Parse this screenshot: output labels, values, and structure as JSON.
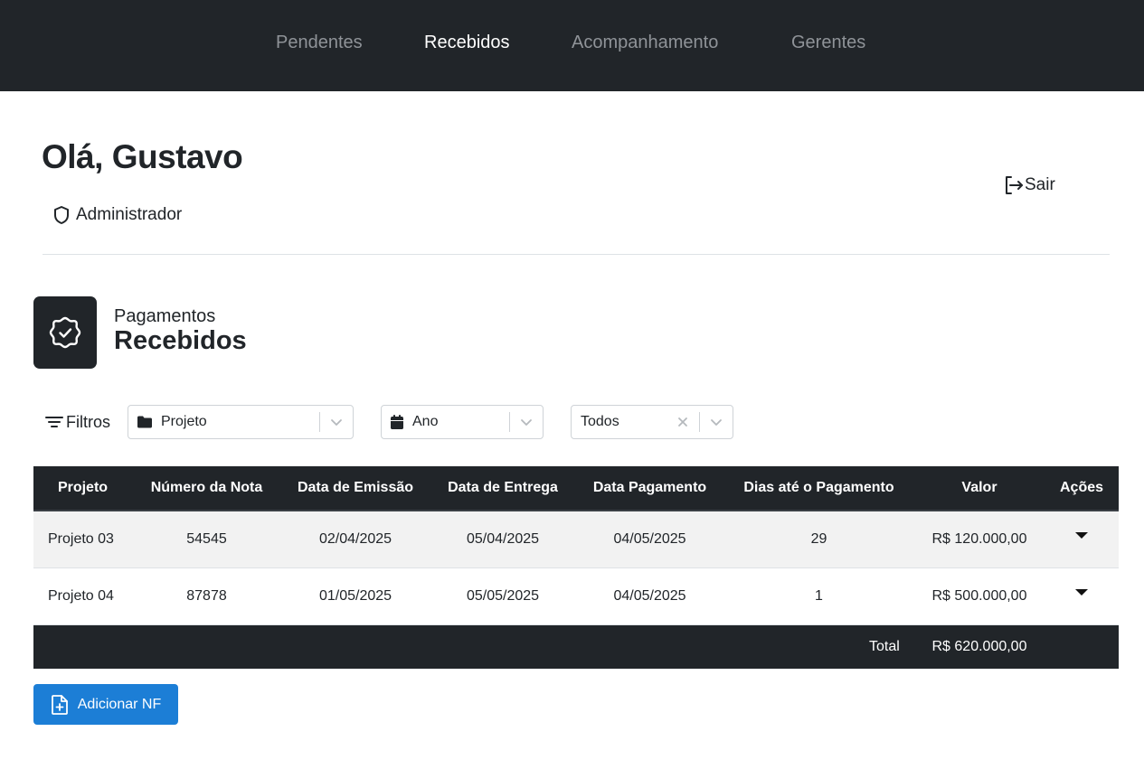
{
  "nav": {
    "items": [
      {
        "label": "Pendentes",
        "active": false
      },
      {
        "label": "Recebidos",
        "active": true
      },
      {
        "label": "Acompanhamento",
        "active": false
      },
      {
        "label": "Gerentes",
        "active": false
      }
    ]
  },
  "header": {
    "greeting": "Olá, Gustavo",
    "role": "Administrador",
    "role_icon": "shield-icon",
    "logout_label": "Sair",
    "logout_icon": "logout-icon"
  },
  "section": {
    "subtitle": "Pagamentos",
    "title": "Recebidos",
    "icon": "badge-check-icon"
  },
  "filters": {
    "label": "Filtros",
    "projeto": {
      "value": "Projeto",
      "icon": "folder-icon"
    },
    "ano": {
      "value": "Ano",
      "icon": "calendar-icon"
    },
    "status": {
      "value": "Todos"
    }
  },
  "table": {
    "headers": [
      "Projeto",
      "Número da Nota",
      "Data de Emissão",
      "Data de Entrega",
      "Data Pagamento",
      "Dias até o Pagamento",
      "Valor",
      "Ações"
    ],
    "rows": [
      {
        "projeto": "Projeto 03",
        "nota": "54545",
        "emissao": "02/04/2025",
        "entrega": "05/04/2025",
        "pagamento": "04/05/2025",
        "dias": "29",
        "valor": "R$ 120.000,00"
      },
      {
        "projeto": "Projeto 04",
        "nota": "87878",
        "emissao": "01/05/2025",
        "entrega": "05/05/2025",
        "pagamento": "04/05/2025",
        "dias": "1",
        "valor": "R$ 500.000,00"
      }
    ],
    "total_label": "Total",
    "total_value": "R$ 620.000,00"
  },
  "actions": {
    "add_label": "Adicionar NF",
    "add_icon": "file-plus-icon"
  },
  "colors": {
    "nav_bg": "#212529",
    "accent": "#1c7ed6",
    "row_stripe": "#f2f2f2"
  }
}
